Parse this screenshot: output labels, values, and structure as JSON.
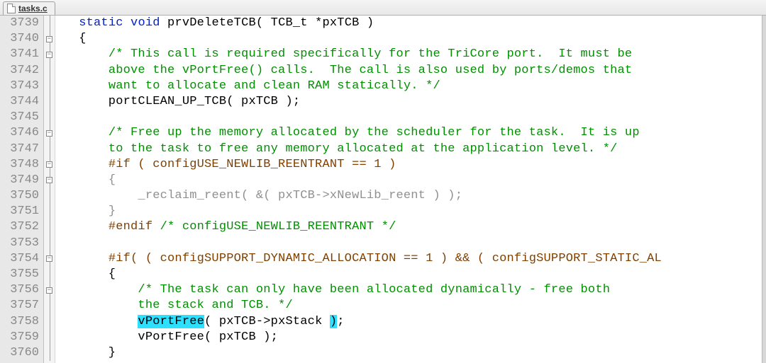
{
  "tab": {
    "filename": "tasks.c"
  },
  "gutter": {
    "start": 3739,
    "end": 3760
  },
  "fold": {
    "boxes": [
      3740,
      3741,
      3746,
      3748,
      3749,
      3754,
      3756
    ]
  },
  "code_lines": [
    {
      "n": 3739,
      "segs": [
        {
          "t": "   "
        },
        {
          "t": "static",
          "c": "kw"
        },
        {
          "t": " "
        },
        {
          "t": "void",
          "c": "kw"
        },
        {
          "t": " prvDeleteTCB( TCB_t *pxTCB )"
        }
      ]
    },
    {
      "n": 3740,
      "segs": [
        {
          "t": "   {"
        }
      ]
    },
    {
      "n": 3741,
      "segs": [
        {
          "t": "       "
        },
        {
          "t": "/* This call is required specifically for the TriCore port.  It must be",
          "c": "cm"
        }
      ]
    },
    {
      "n": 3742,
      "segs": [
        {
          "t": "       "
        },
        {
          "t": "above the vPortFree() calls.  The call is also used by ports/demos that",
          "c": "cm"
        }
      ]
    },
    {
      "n": 3743,
      "segs": [
        {
          "t": "       "
        },
        {
          "t": "want to allocate and clean RAM statically. */",
          "c": "cm"
        }
      ]
    },
    {
      "n": 3744,
      "segs": [
        {
          "t": "       portCLEAN_UP_TCB( pxTCB );"
        }
      ]
    },
    {
      "n": 3745,
      "segs": [
        {
          "t": ""
        }
      ]
    },
    {
      "n": 3746,
      "segs": [
        {
          "t": "       "
        },
        {
          "t": "/* Free up the memory allocated by the scheduler for the task.  It is up",
          "c": "cm"
        }
      ]
    },
    {
      "n": 3747,
      "segs": [
        {
          "t": "       "
        },
        {
          "t": "to the task to free any memory allocated at the application level. */",
          "c": "cm"
        }
      ]
    },
    {
      "n": 3748,
      "segs": [
        {
          "t": "       "
        },
        {
          "t": "#if ( configUSE_NEWLIB_REENTRANT == 1 )",
          "c": "prep"
        }
      ]
    },
    {
      "n": 3749,
      "segs": [
        {
          "t": "       "
        },
        {
          "t": "{",
          "c": "deadblk"
        }
      ]
    },
    {
      "n": 3750,
      "segs": [
        {
          "t": "           "
        },
        {
          "t": "_reclaim_reent( &( pxTCB->xNewLib_reent ) );",
          "c": "deadblk"
        }
      ]
    },
    {
      "n": 3751,
      "segs": [
        {
          "t": "       "
        },
        {
          "t": "}",
          "c": "deadblk"
        }
      ]
    },
    {
      "n": 3752,
      "segs": [
        {
          "t": "       "
        },
        {
          "t": "#endif",
          "c": "prep"
        },
        {
          "t": " "
        },
        {
          "t": "/* configUSE_NEWLIB_REENTRANT */",
          "c": "cm"
        }
      ]
    },
    {
      "n": 3753,
      "segs": [
        {
          "t": ""
        }
      ]
    },
    {
      "n": 3754,
      "segs": [
        {
          "t": "       "
        },
        {
          "t": "#if( ( configSUPPORT_DYNAMIC_ALLOCATION == 1 ) && ( configSUPPORT_STATIC_AL",
          "c": "prep"
        }
      ]
    },
    {
      "n": 3755,
      "segs": [
        {
          "t": "       {"
        }
      ]
    },
    {
      "n": 3756,
      "segs": [
        {
          "t": "           "
        },
        {
          "t": "/* The task can only have been allocated dynamically - free both",
          "c": "cm"
        }
      ]
    },
    {
      "n": 3757,
      "segs": [
        {
          "t": "           "
        },
        {
          "t": "the stack and TCB. */",
          "c": "cm"
        }
      ]
    },
    {
      "n": 3758,
      "segs": [
        {
          "t": "           "
        },
        {
          "t": "vPortFree",
          "c": "hl"
        },
        {
          "t": "( pxTCB->pxStack "
        },
        {
          "t": ")",
          "c": "hl"
        },
        {
          "t": ";"
        }
      ]
    },
    {
      "n": 3759,
      "segs": [
        {
          "t": "           vPortFree( pxTCB );"
        }
      ]
    },
    {
      "n": 3760,
      "segs": [
        {
          "t": "       }"
        }
      ]
    }
  ]
}
